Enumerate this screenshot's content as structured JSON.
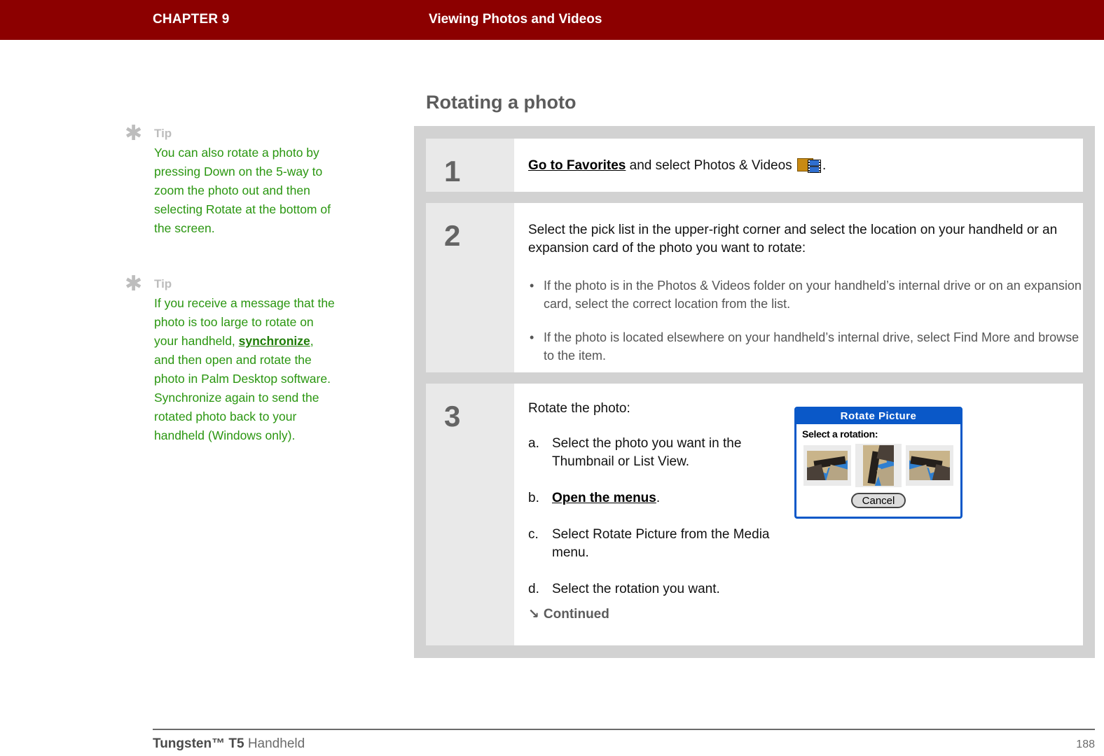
{
  "header": {
    "chapter": "CHAPTER 9",
    "title": "Viewing Photos and Videos",
    "bg_color": "#8C0000"
  },
  "sidebar": {
    "tips": [
      {
        "star_icon": "asterisk-icon",
        "label": "Tip",
        "text_before_link": "You can also rotate a photo by pressing Down on the 5-way to zoom the photo out and then selecting Rotate at the bottom of the screen.",
        "link": "",
        "text_after_link": ""
      },
      {
        "star_icon": "asterisk-icon",
        "label": "Tip",
        "text_before_link": "If you receive a message that the photo is too large to rotate on your handheld, ",
        "link": "synchronize",
        "text_after_link": ", and then open and rotate the photo in Palm Desktop software. Synchronize again to send the rotated photo back to your handheld (Windows only)."
      }
    ],
    "tip_text_color": "#2A9610"
  },
  "main": {
    "section_title": "Rotating a photo",
    "steps": [
      {
        "number": "1",
        "link": "Go to Favorites",
        "text_after_link": " and select Photos & Videos ",
        "icon": "photos-and-videos-icon",
        "trailing": "."
      },
      {
        "number": "2",
        "lead": "Select the pick list in the upper-right corner and select the location on your handheld or an expansion card of the photo you want to rotate:",
        "bullets": [
          "If the photo is in the Photos & Videos folder on your handheld’s internal drive or on an expansion card, select the correct location from the list.",
          "If the photo is located elsewhere on your handheld’s internal drive, select Find More and browse to the item."
        ]
      },
      {
        "number": "3",
        "lead": "Rotate the photo:",
        "items": [
          {
            "mark": "a.",
            "text": "Select the photo you want in the Thumbnail or List View.",
            "link": "",
            "after": ""
          },
          {
            "mark": "b.",
            "text": "",
            "link": "Open the menus",
            "after": "."
          },
          {
            "mark": "c.",
            "text": "Select Rotate Picture from the Media menu.",
            "link": "",
            "after": ""
          },
          {
            "mark": "d.",
            "text": "Select the rotation you want.",
            "link": "",
            "after": ""
          }
        ],
        "continued_arrow": "↘",
        "continued_label": "Continued"
      }
    ]
  },
  "dialog": {
    "title": "Rotate Picture",
    "prompt": "Select a rotation:",
    "cancel_label": "Cancel",
    "title_bg": "#0A58C8",
    "thumbnails": [
      {
        "name": "rotation-option-landscape-left",
        "orientation": "landscape"
      },
      {
        "name": "rotation-option-portrait",
        "orientation": "portrait"
      },
      {
        "name": "rotation-option-landscape-right",
        "orientation": "landscape"
      }
    ]
  },
  "footer": {
    "product_bold": "Tungsten™ T5",
    "product_rest": " Handheld",
    "page_number": "188"
  }
}
